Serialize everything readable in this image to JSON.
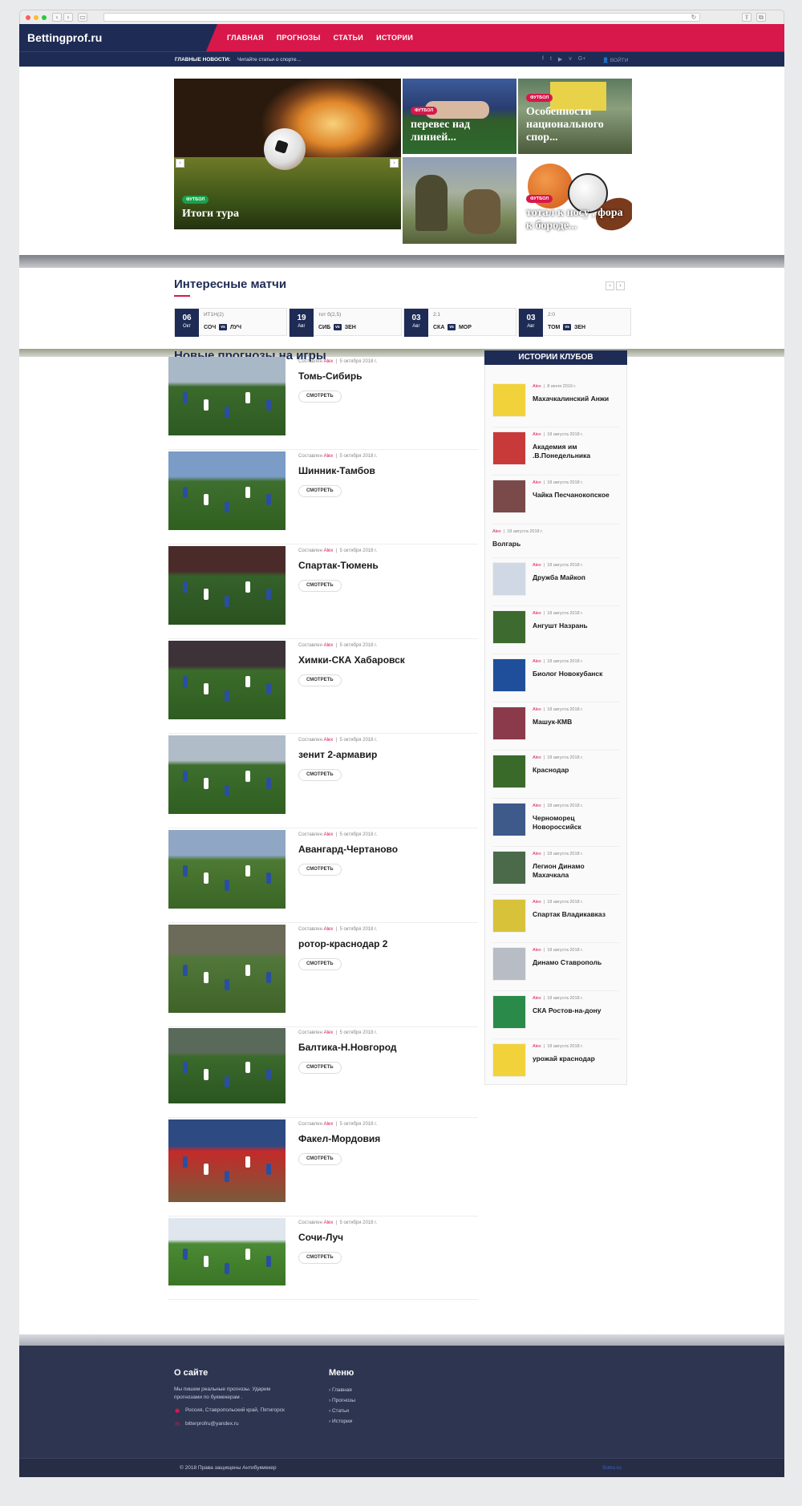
{
  "header": {
    "logo": "Bettingprof.ru",
    "nav": [
      "ГЛАВНАЯ",
      "ПРОГНОЗЫ",
      "СТАТЬИ",
      "ИСТОРИИ"
    ],
    "news_label": "ГЛАВНЫЕ НОВОСТИ:",
    "news_text": "Читайте статьи о спорте...",
    "social_icons": [
      "facebook-icon",
      "twitter-icon",
      "youtube-icon",
      "vk-icon",
      "google-plus-icon"
    ],
    "social_glyphs": [
      "f",
      "t",
      "▶",
      "v",
      "G+"
    ],
    "login": "ВОЙТИ"
  },
  "featured": [
    {
      "badge": "ФУТБОЛ",
      "title": "Итоги тура"
    },
    {
      "badge": "ФУТБОЛ",
      "title": "перевес над линией..."
    },
    {
      "badge": "ФУТБОЛ",
      "title": "Особенности национального спор..."
    },
    {
      "badge": "",
      "title": ""
    },
    {
      "badge": "ФУТБОЛ",
      "title": "тотал к носу , фора к бороде..."
    }
  ],
  "matches_section": {
    "title": "Интересные матчи",
    "items": [
      {
        "day": "06",
        "month": "Окт",
        "tip": "ИТ1Н(2)",
        "home": "СОЧ",
        "away": "ЛУЧ"
      },
      {
        "day": "19",
        "month": "Авг",
        "tip": "тот б(2,5)",
        "home": "СИБ",
        "away": "ЗЕН"
      },
      {
        "day": "03",
        "month": "Авг",
        "tip": "2:1",
        "home": "СКА",
        "away": "МОР"
      },
      {
        "day": "03",
        "month": "Авг",
        "tip": "2:0",
        "home": "ТОМ",
        "away": "ЗЕН"
      }
    ]
  },
  "predictions": {
    "title": "Новые прогнозы на игры",
    "meta_prefix": "Составлен",
    "author": "Alex",
    "date": "5 октября 2018 г.",
    "button": "СМОТРЕТЬ",
    "items": [
      {
        "title": "Томь-Сибирь"
      },
      {
        "title": "Шинник-Тамбов"
      },
      {
        "title": "Спартак-Тюмень"
      },
      {
        "title": "Химки-СКА Хабаровск"
      },
      {
        "title": "зенит 2-армавир"
      },
      {
        "title": "Авангард-Чертаново"
      },
      {
        "title": "ротор-краснодар 2"
      },
      {
        "title": "Балтика-Н.Новгород"
      },
      {
        "title": "Факел-Мордовия"
      },
      {
        "title": "Сочи-Луч"
      }
    ]
  },
  "clubs": {
    "title": "ИСТОРИИ КЛУБОВ",
    "items": [
      {
        "author": "Alex",
        "date": "8 июля 2019 г.",
        "name": "Махачкалинский Анжи"
      },
      {
        "author": "Alex",
        "date": "18 августа 2018 г.",
        "name": "Академия им .В.Понедельника"
      },
      {
        "author": "Alex",
        "date": "18 августа 2018 г.",
        "name": "Чайка Песчанокопское"
      },
      {
        "author": "Alex",
        "date": "18 августа 2018 г.",
        "name": "Волгарь"
      },
      {
        "author": "Alex",
        "date": "18 августа 2018 г.",
        "name": "Дружба Майкоп"
      },
      {
        "author": "Alex",
        "date": "18 августа 2018 г.",
        "name": "Ангушт Назрань"
      },
      {
        "author": "Alex",
        "date": "18 августа 2018 г.",
        "name": "Биолог Новокубанск"
      },
      {
        "author": "Alex",
        "date": "18 августа 2018 г.",
        "name": "Машук-КМВ"
      },
      {
        "author": "Alex",
        "date": "18 августа 2018 г.",
        "name": "Краснодар"
      },
      {
        "author": "Alex",
        "date": "18 августа 2018 г.",
        "name": "Черноморец Новороссийск"
      },
      {
        "author": "Alex",
        "date": "18 августа 2018 г.",
        "name": "Легион Динамо Махачкала"
      },
      {
        "author": "Alex",
        "date": "18 августа 2018 г.",
        "name": "Спартак Владикавказ"
      },
      {
        "author": "Alex",
        "date": "18 августа 2018 г.",
        "name": "Динамо Ставрополь"
      },
      {
        "author": "Alex",
        "date": "18 августа 2018 г.",
        "name": "СКА Ростов-на-дону"
      },
      {
        "author": "Alex",
        "date": "18 августа 2018 г.",
        "name": "урожай краснодар"
      }
    ]
  },
  "footer": {
    "about_title": "О сайте",
    "about_text": "Мы пишем реальные прогнозы. Ударим прогнозами по букмекерам .",
    "address": "Россия, Ставропольский край, Пятигорск",
    "email": "bitterprofru@yandex.ru",
    "menu_title": "Меню",
    "menu": [
      "Главная",
      "Прогнозы",
      "Статьи",
      "Истории"
    ],
    "copyright": "© 2018 Права защищены Антибукмекер",
    "link": "Sotcs.ru"
  },
  "colors": {
    "navy": "#1e2b55",
    "accent": "#d8174a",
    "footer": "#2d3550",
    "green": "#18a14a"
  }
}
